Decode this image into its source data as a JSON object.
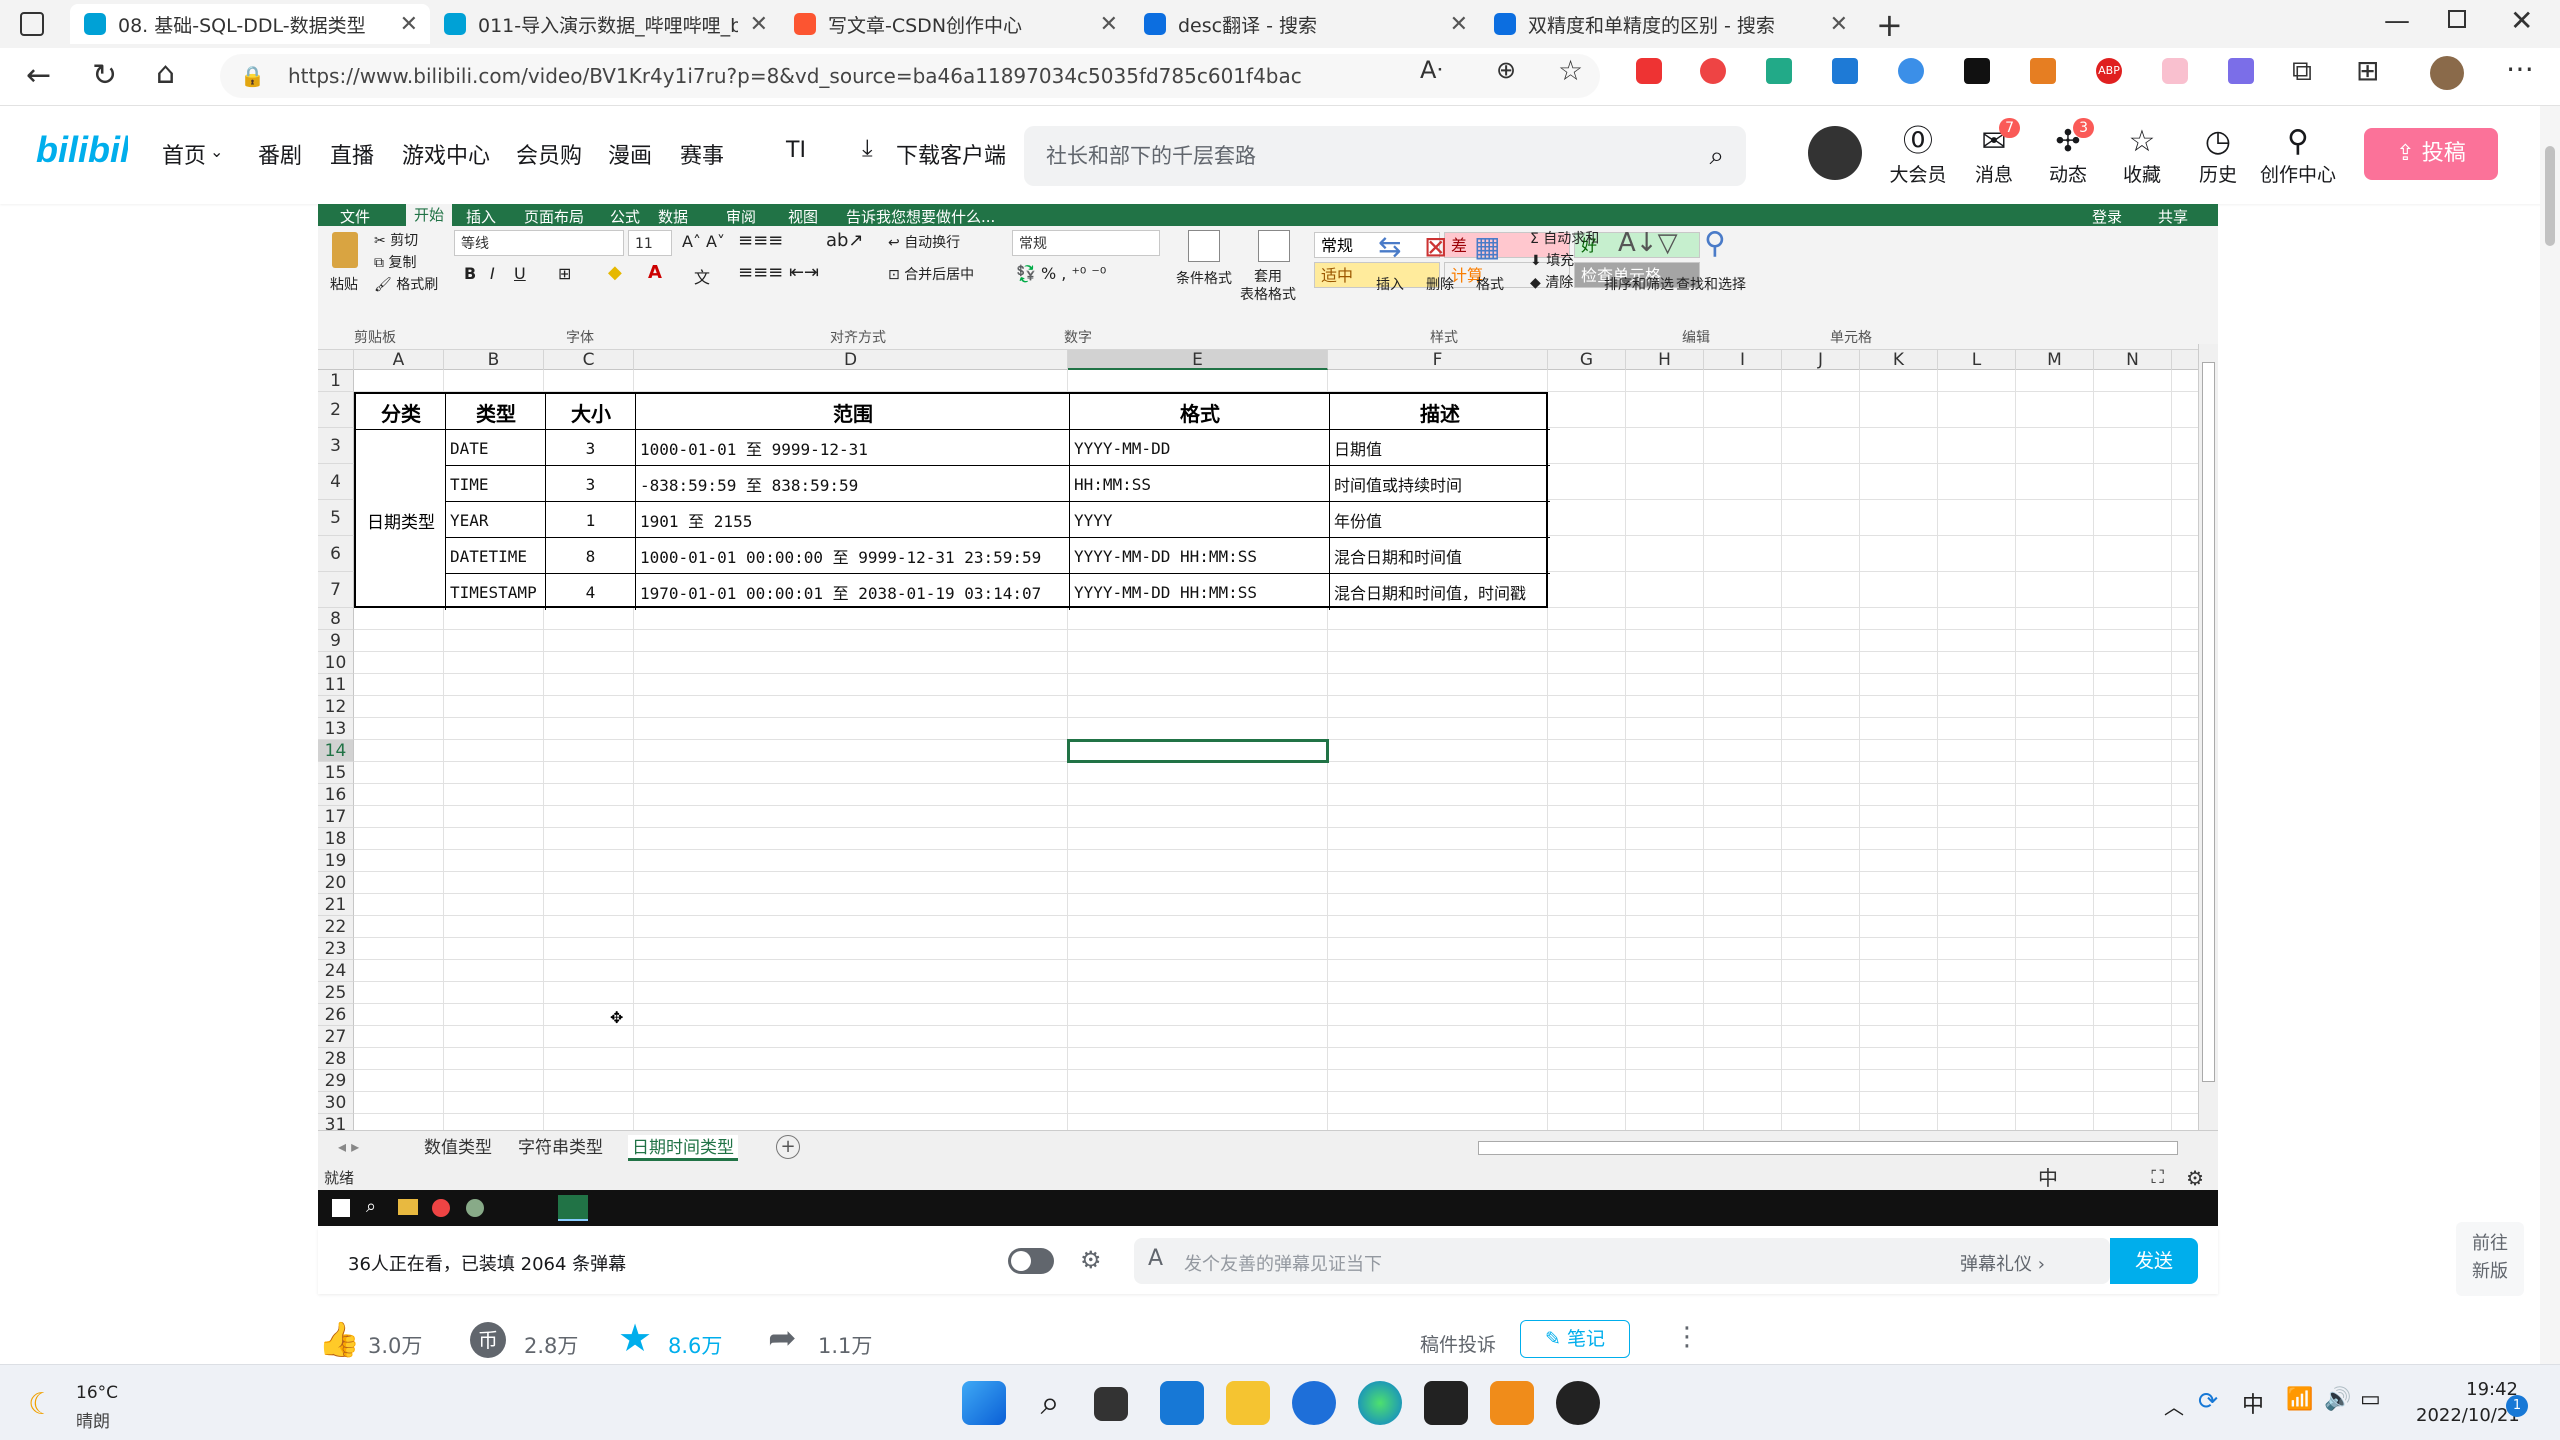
{
  "browser": {
    "tabs": [
      {
        "label": "08. 基础-SQL-DDL-数据类型",
        "icon": "bilibili-tv-icon",
        "color": "#00a1d6"
      },
      {
        "label": "011-导入演示数据_哔哩哔哩_bili",
        "icon": "bilibili-tv-icon",
        "color": "#00a1d6"
      },
      {
        "label": "写文章-CSDN创作中心",
        "icon": "csdn-c-icon",
        "color": "#fc5531"
      },
      {
        "label": "desc翻译 - 搜索",
        "icon": "search-icon",
        "color": "#0c6ee0"
      },
      {
        "label": "双精度和单精度的区别 - 搜索",
        "icon": "search-icon",
        "color": "#0c6ee0"
      }
    ],
    "url": "https://www.bilibili.com/video/BV1Kr4y1i7ru?p=8&vd_source=ba46a11897034c5035fd785c601f4bac"
  },
  "bili": {
    "nav": [
      "首页",
      "番剧",
      "直播",
      "游戏中心",
      "会员购",
      "漫画",
      "赛事",
      "TI"
    ],
    "download": "下载客户端",
    "search_placeholder": "社长和部下的千层套路",
    "user_items": [
      {
        "label": "大会员",
        "icon": "vip-icon"
      },
      {
        "label": "消息",
        "icon": "message-icon",
        "badge": "7"
      },
      {
        "label": "动态",
        "icon": "dynamic-icon",
        "badge": "3"
      },
      {
        "label": "收藏",
        "icon": "star-icon"
      },
      {
        "label": "历史",
        "icon": "clock-icon"
      },
      {
        "label": "创作中心",
        "icon": "bulb-icon"
      }
    ],
    "upload": "投稿",
    "watching": "36人正在看，已装填 2064 条弹幕",
    "danmu_placeholder": "发个友善的弹幕见证当下",
    "danmu_gift": "弹幕礼仪 ›",
    "send": "发送",
    "side_btn": [
      "前往",
      "新版"
    ],
    "stats": {
      "like": "3.0万",
      "coin": "2.8万",
      "fav": "8.6万",
      "share": "1.1万"
    },
    "report": "稿件投诉",
    "note": "笔记"
  },
  "excel": {
    "ribbon_tabs": [
      "文件",
      "开始",
      "插入",
      "页面布局",
      "公式",
      "数据",
      "审阅",
      "视图"
    ],
    "tell_me": "告诉我您想要做什么...",
    "login": "登录",
    "share": "共享",
    "font_name": "等线",
    "font_size": "11",
    "number_format": "常规",
    "clipboard": [
      "剪切",
      "复制",
      "格式刷",
      "粘贴"
    ],
    "align_items": [
      "自动换行",
      "合并后居中"
    ],
    "style_buttons": [
      "条件格式",
      "套用\n表格格式"
    ],
    "styles": [
      {
        "label": "常规",
        "bg": "#ffffff",
        "fg": "#000000"
      },
      {
        "label": "差",
        "bg": "#ffc7ce",
        "fg": "#9c0006"
      },
      {
        "label": "好",
        "bg": "#c6efce",
        "fg": "#006100"
      },
      {
        "label": "适中",
        "bg": "#ffeb9c",
        "fg": "#9c5700"
      },
      {
        "label": "计算",
        "bg": "#f2f2f2",
        "fg": "#fa7d00"
      },
      {
        "label": "检查单元格",
        "bg": "#a5a5a5",
        "fg": "#ffffff"
      }
    ],
    "cell_items": [
      "插入",
      "删除",
      "格式"
    ],
    "edit_items": [
      "自动求和",
      "填充",
      "清除",
      "排序和筛选",
      "查找和选择"
    ],
    "groups": [
      "剪贴板",
      "字体",
      "对齐方式",
      "数字",
      "样式",
      "单元格",
      "编辑"
    ],
    "columns": [
      "A",
      "B",
      "C",
      "D",
      "E",
      "F",
      "G",
      "H",
      "I",
      "J",
      "K",
      "L",
      "M",
      "N"
    ],
    "rows": [
      "1",
      "2",
      "3",
      "4",
      "5",
      "6",
      "7",
      "8",
      "9",
      "10",
      "11",
      "12",
      "13",
      "14",
      "15",
      "16",
      "17",
      "18",
      "19",
      "20",
      "21",
      "22",
      "23",
      "24",
      "25",
      "26",
      "27",
      "28",
      "29",
      "30",
      "31"
    ],
    "table_header": [
      "分类",
      "类型",
      "大小",
      "范围",
      "格式",
      "描述"
    ],
    "category": "日期类型",
    "table_rows": [
      [
        "DATE",
        "3",
        "1000-01-01 至 9999-12-31",
        "YYYY-MM-DD",
        "日期值"
      ],
      [
        "TIME",
        "3",
        "-838:59:59 至 838:59:59",
        "HH:MM:SS",
        "时间值或持续时间"
      ],
      [
        "YEAR",
        "1",
        "1901 至 2155",
        "YYYY",
        "年份值"
      ],
      [
        "DATETIME",
        "8",
        "1000-01-01 00:00:00 至 9999-12-31 23:59:59",
        "YYYY-MM-DD HH:MM:SS",
        "混合日期和时间值"
      ],
      [
        "TIMESTAMP",
        "4",
        "1970-01-01 00:00:01 至 2038-01-19 03:14:07",
        "YYYY-MM-DD HH:MM:SS",
        "混合日期和时间值，时间戳"
      ]
    ],
    "sheets": [
      "数值类型",
      "字符串类型",
      "日期时间类型"
    ],
    "status": "就绪"
  },
  "os": {
    "weather_temp": "16°C",
    "weather_desc": "晴朗",
    "ime": "中",
    "time": "19:42",
    "date": "2022/10/21"
  }
}
